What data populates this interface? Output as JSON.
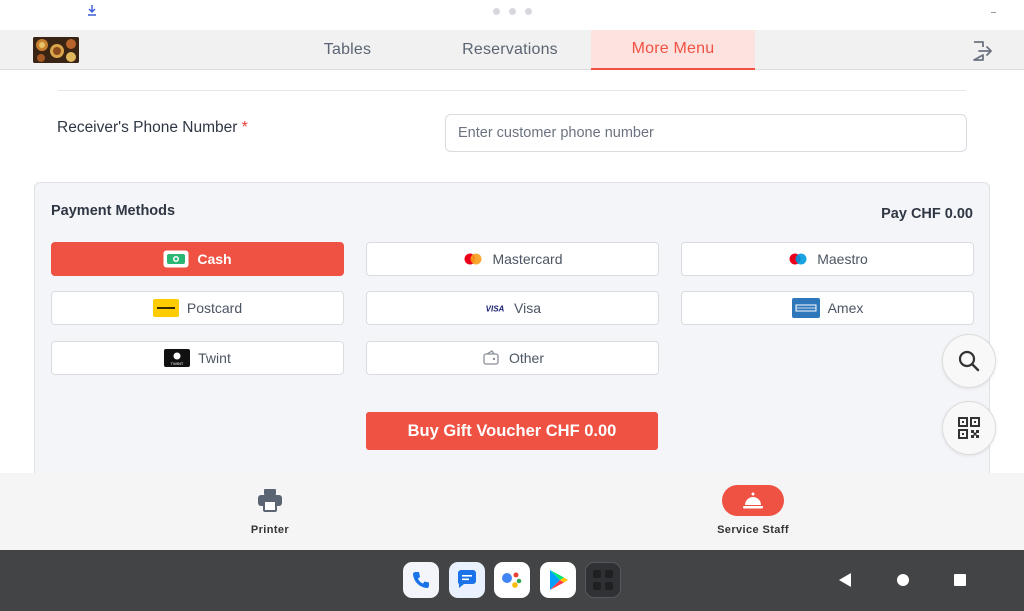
{
  "nav": {
    "tabs": [
      {
        "label": "Tables"
      },
      {
        "label": "Reservations"
      },
      {
        "label": "More Menu",
        "active": true
      }
    ]
  },
  "form": {
    "phone_label": "Receiver's Phone Number",
    "required_mark": "*",
    "phone_value": "",
    "phone_placeholder": "Enter customer phone number"
  },
  "payment": {
    "title": "Payment Methods",
    "total": "Pay CHF 0.00",
    "methods": [
      {
        "label": "Cash",
        "icon": "cash-icon",
        "selected": true
      },
      {
        "label": "Mastercard",
        "icon": "mastercard-icon",
        "selected": false
      },
      {
        "label": "Maestro",
        "icon": "maestro-icon",
        "selected": false
      },
      {
        "label": "Postcard",
        "icon": "postcard-icon",
        "selected": false
      },
      {
        "label": "Visa",
        "icon": "visa-icon",
        "icon_text": "VISA",
        "selected": false
      },
      {
        "label": "Amex",
        "icon": "amex-icon",
        "selected": false
      },
      {
        "label": "Twint",
        "icon": "twint-icon",
        "icon_text": "TWINT",
        "selected": false
      },
      {
        "label": "Other",
        "icon": "wallet-icon",
        "selected": false
      }
    ],
    "gift_button": "Buy Gift Voucher CHF 0.00"
  },
  "bottom_nav": {
    "printer": "Printer",
    "service_staff": "Service Staff"
  },
  "colors": {
    "accent": "#ef5142",
    "accent_light": "#fde3e0",
    "panel_bg": "#f4f5f8",
    "system_bar": "#424446"
  }
}
